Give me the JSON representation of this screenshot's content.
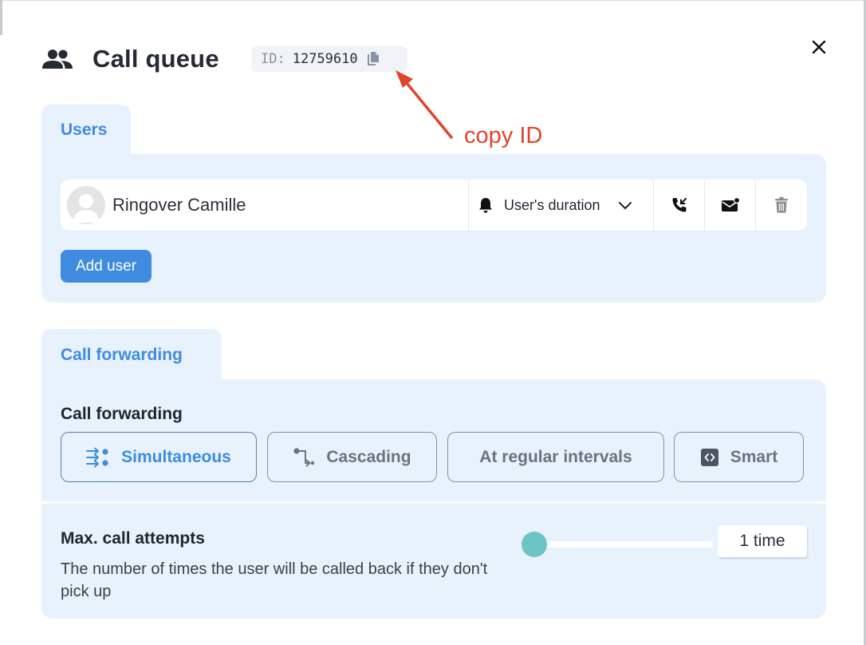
{
  "header": {
    "title": "Call queue",
    "id_label": "ID:",
    "id_value": "12759610",
    "icon": "people-icon",
    "copy_icon": "copy-icon",
    "close_icon": "close-icon"
  },
  "annotation": {
    "text": "copy ID",
    "color": "#e0452c"
  },
  "users": {
    "tab_label": "Users",
    "rows": [
      {
        "name": "Ringover Camille",
        "duration_option": "User's duration",
        "icons": [
          "bell-icon",
          "chevron-down-icon",
          "call-back-icon",
          "voicemail-icon",
          "trash-icon"
        ]
      }
    ],
    "add_button": "Add user"
  },
  "call_forwarding": {
    "tab_label": "Call forwarding",
    "heading": "Call forwarding",
    "modes": [
      {
        "label": "Simultaneous",
        "icon": "simultaneous-icon",
        "active": true
      },
      {
        "label": "Cascading",
        "icon": "cascading-icon",
        "active": false
      },
      {
        "label": "At regular intervals",
        "icon": "",
        "active": false
      },
      {
        "label": "Smart",
        "icon": "smart-code-icon",
        "active": false
      }
    ]
  },
  "max_attempts": {
    "title": "Max. call attempts",
    "description": "The number of times the user will be called back if they don't pick up",
    "slider_fraction": 0,
    "value_label": "1 time"
  },
  "colors": {
    "accent": "#3e8be0",
    "panel_bg": "#e8f2fc",
    "slider": "#6cc4c4"
  }
}
